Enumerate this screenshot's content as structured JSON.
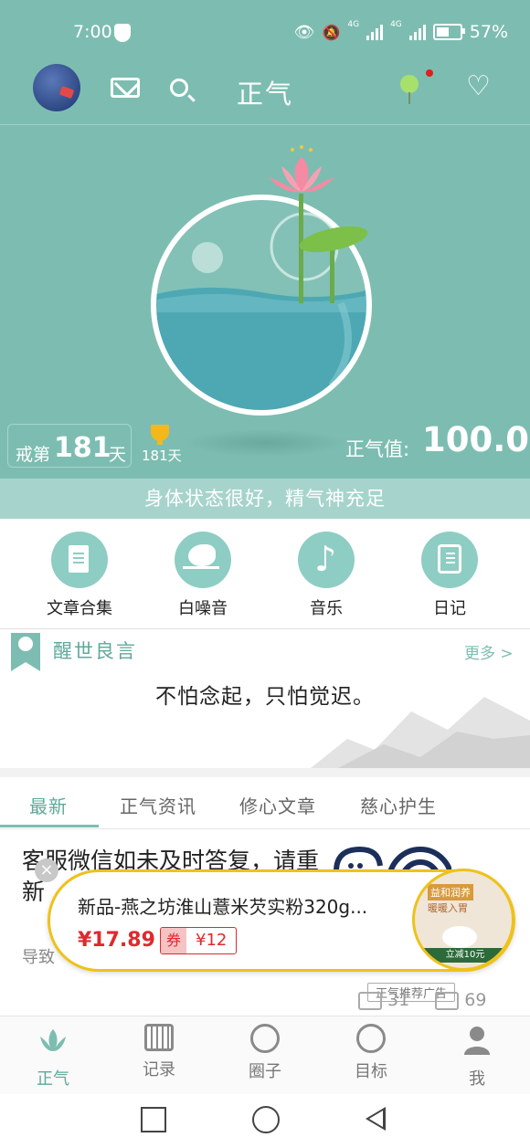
{
  "status_bar": {
    "time": "7:00",
    "network_1": "4G",
    "network_2": "4G",
    "battery": "57%",
    "battery_level": 0.57
  },
  "header": {
    "title": "正气"
  },
  "hero": {
    "streak_prefix": "戒第",
    "streak_days": "181",
    "streak_suffix": "天",
    "trophy_days": "181天",
    "zhengqi_label": "正气值:",
    "zhengqi_value": "100.0",
    "status_message": "身体状态很好，精气神充足"
  },
  "quick_menu": [
    {
      "label": "文章合集",
      "icon": "document-icon"
    },
    {
      "label": "白噪音",
      "icon": "bird-icon"
    },
    {
      "label": "音乐",
      "icon": "music-note-icon"
    },
    {
      "label": "日记",
      "icon": "diary-icon"
    }
  ],
  "quote_section": {
    "title": "醒世良言",
    "more": "更多 >",
    "text": "不怕念起，只怕觉迟。"
  },
  "tabs": [
    {
      "label": "最新",
      "active": true
    },
    {
      "label": "正气资讯",
      "active": false
    },
    {
      "label": "修心文章",
      "active": false
    },
    {
      "label": "慈心护生",
      "active": false
    }
  ],
  "article": {
    "title": "客服微信如未及时答复，请重新",
    "summary": "导致",
    "ad_tag": "正气推荐广告",
    "comments": "31",
    "views": "69"
  },
  "ad_popup": {
    "close": "×",
    "title": "新品-燕之坊淮山薏米芡实粉320g...",
    "price": "¥17.89",
    "coupon_tag": "券",
    "coupon_value": "¥12",
    "thumb_text_1": "益和润养",
    "thumb_text_2": "暖暖入胃",
    "thumb_text_3": "立减10元"
  },
  "bottom_nav": [
    {
      "label": "正气",
      "icon": "lotus-icon",
      "active": true
    },
    {
      "label": "记录",
      "icon": "calendar-icon",
      "active": false
    },
    {
      "label": "圈子",
      "icon": "circle-icon",
      "active": false
    },
    {
      "label": "目标",
      "icon": "target-icon",
      "active": false
    },
    {
      "label": "我",
      "icon": "person-icon",
      "active": false
    }
  ],
  "colors": {
    "theme_teal": "#7dbdb1",
    "accent_green": "#5fa89b",
    "price_red": "#e0292e",
    "ad_border": "#eec21b"
  }
}
